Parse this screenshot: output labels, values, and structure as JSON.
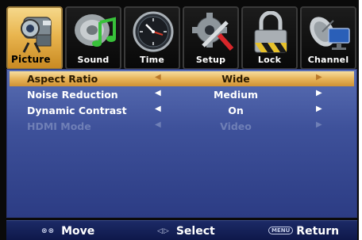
{
  "tabs": [
    {
      "label": "Picture",
      "icon": "camera-icon",
      "active": true
    },
    {
      "label": "Sound",
      "icon": "music-note-icon",
      "active": false
    },
    {
      "label": "Time",
      "icon": "clock-icon",
      "active": false
    },
    {
      "label": "Setup",
      "icon": "gear-wrench-icon",
      "active": false
    },
    {
      "label": "Lock",
      "icon": "padlock-icon",
      "active": false
    },
    {
      "label": "Channel",
      "icon": "satellite-dish-icon",
      "active": false
    }
  ],
  "menu": {
    "items": [
      {
        "label": "Aspect Ratio",
        "value": "Wide",
        "selected": true,
        "enabled": true
      },
      {
        "label": "Noise Reduction",
        "value": "Medium",
        "selected": false,
        "enabled": true
      },
      {
        "label": "Dynamic Contrast",
        "value": "On",
        "selected": false,
        "enabled": true
      },
      {
        "label": "HDMI Mode",
        "value": "Video",
        "selected": false,
        "enabled": false
      }
    ],
    "arrow_left": "◀",
    "arrow_right": "▶"
  },
  "help": {
    "move_keys": "⊗⊗",
    "move_label": "Move",
    "select_keys": "◁▷",
    "select_label": "Select",
    "return_key": "MENU",
    "return_label": "Return"
  },
  "colors": {
    "active_tab": "#e9b54f",
    "panel": "#3e519a",
    "selected_row": "#e7b459",
    "disabled_text": "#6f7fb6"
  }
}
